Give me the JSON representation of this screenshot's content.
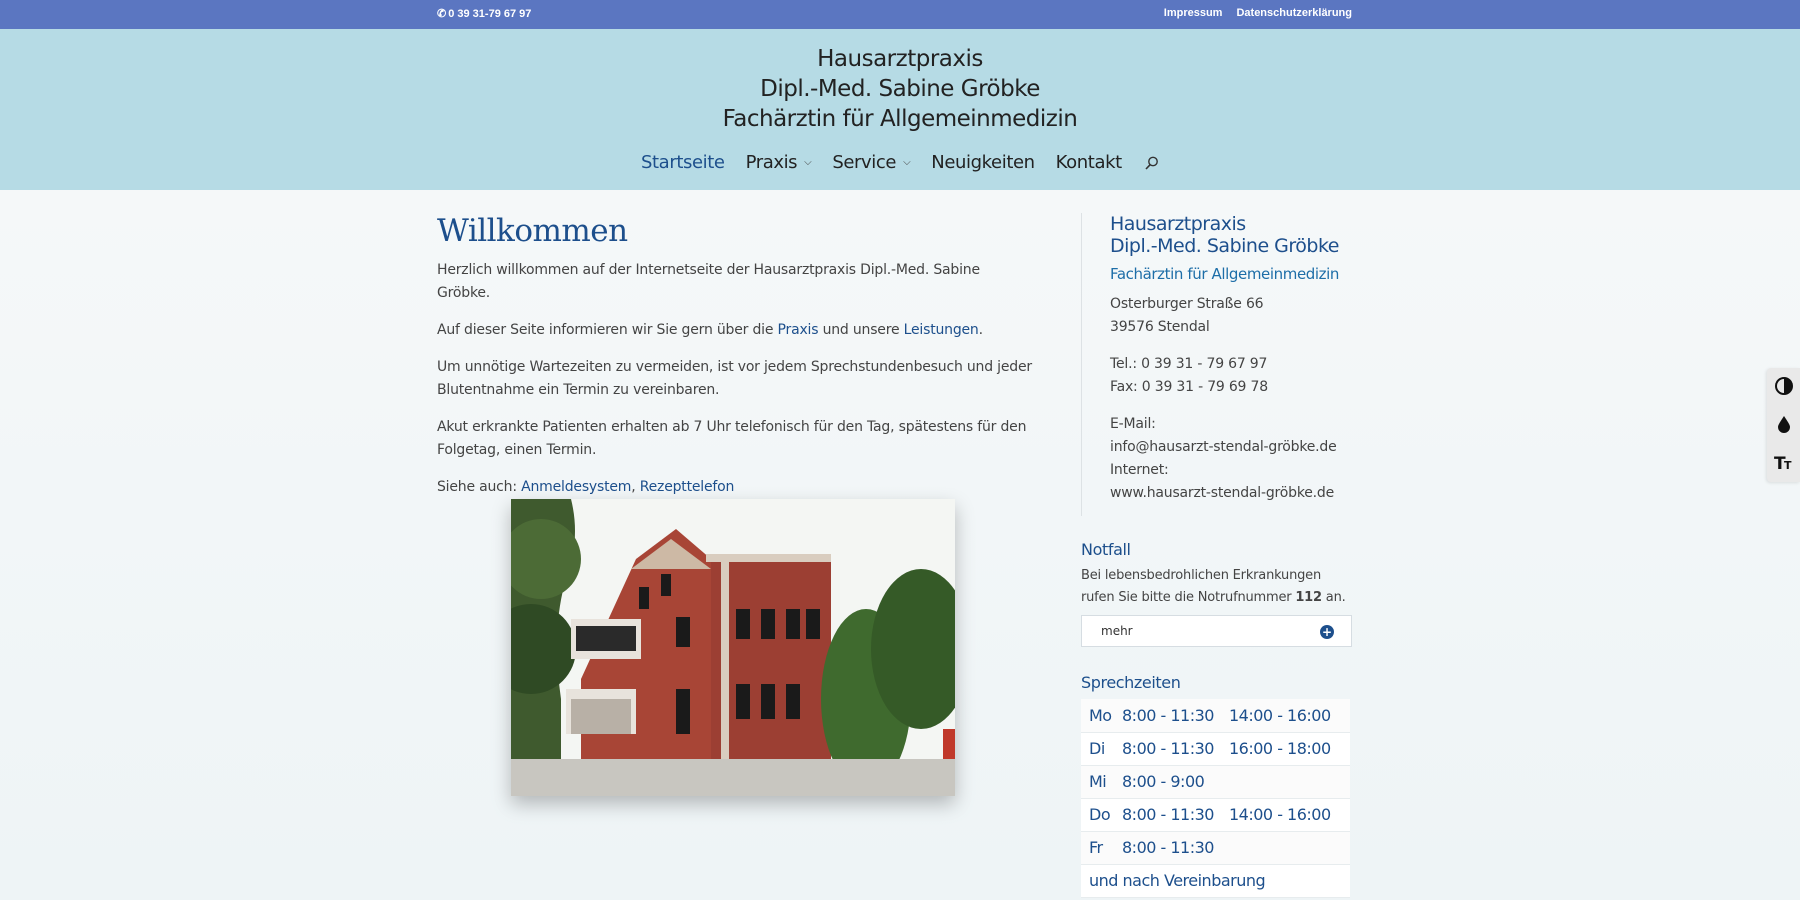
{
  "topbar": {
    "phone": "0 39 31-79 67 97",
    "links": [
      "Impressum",
      "Datenschutzerklärung"
    ]
  },
  "header": {
    "logo_lines": [
      "Hausarztpraxis",
      "Dipl.-Med. Sabine Gröbke",
      "Fachärztin für Allgemeinmedizin"
    ],
    "nav": [
      "Startseite",
      "Praxis",
      "Service",
      "Neuigkeiten",
      "Kontakt"
    ]
  },
  "main": {
    "title": "Willkommen",
    "p1": "Herzlich willkommen auf der Internetseite der Hausarztpraxis Dipl.-Med. Sabine Gröbke.",
    "p2_pre": "Auf dieser Seite informieren wir Sie gern über die ",
    "p2_link1": "Praxis",
    "p2_mid": " und unsere ",
    "p2_link2": "Leistungen",
    "p2_post": ".",
    "p3": "Um unnötige Wartezeiten zu vermeiden, ist vor jedem Sprechstundenbesuch und jeder Blutentnahme ein Termin zu vereinbaren.",
    "p4": "Akut erkrankte Patienten erhalten ab 7 Uhr telefonisch für den Tag, spätestens für den Folgetag, einen Termin.",
    "p5_pre": "Siehe auch: ",
    "p5_link1": "Anmeldesystem",
    "p5_sep": ", ",
    "p5_link2": "Rezepttelefon"
  },
  "sidebar": {
    "title1": "Hausarztpraxis",
    "title2": "Dipl.-Med. Sabine Gröbke",
    "subtitle": "Fachärztin für Allgemeinmedizin",
    "street": "Osterburger Straße 66",
    "city": "39576 Stendal",
    "tel": "Tel.: 0 39 31 - 79 67 97",
    "fax": "Fax: 0 39 31 - 79 69 78",
    "email_label": "E-Mail:",
    "email": "info@hausarzt-stendal-gröbke.de",
    "internet_label": "Internet:",
    "internet": "www.hausarzt-stendal-gröbke.de"
  },
  "notfall": {
    "title": "Notfall",
    "text_pre": "Bei lebensbedrohlichen Erkrankungen rufen Sie bitte die Notrufnummer ",
    "number": "112",
    "text_post": " an.",
    "more": "mehr"
  },
  "sprechzeiten": {
    "title": "Sprechzeiten",
    "rows": [
      {
        "day": "Mo",
        "am": "8:00 - 11:30",
        "pm": "14:00 - 16:00"
      },
      {
        "day": "Di",
        "am": "8:00 - 11:30",
        "pm": "16:00 - 18:00"
      },
      {
        "day": "Mi",
        "am": "8:00 - 9:00",
        "pm": ""
      },
      {
        "day": "Do",
        "am": "8:00 - 11:30",
        "pm": "14:00 - 16:00"
      },
      {
        "day": "Fr",
        "am": "8:00 - 11:30",
        "pm": ""
      }
    ],
    "footer": "und nach Vereinbarung"
  },
  "colors": {
    "topbar": "#5b76c1",
    "header": "#b6dbe5",
    "accent": "#1d4f8c"
  },
  "icons": [
    "phone-icon",
    "search-icon",
    "chevron-down-icon",
    "plus-circle-icon",
    "contrast-icon",
    "drop-icon",
    "font-size-icon"
  ]
}
